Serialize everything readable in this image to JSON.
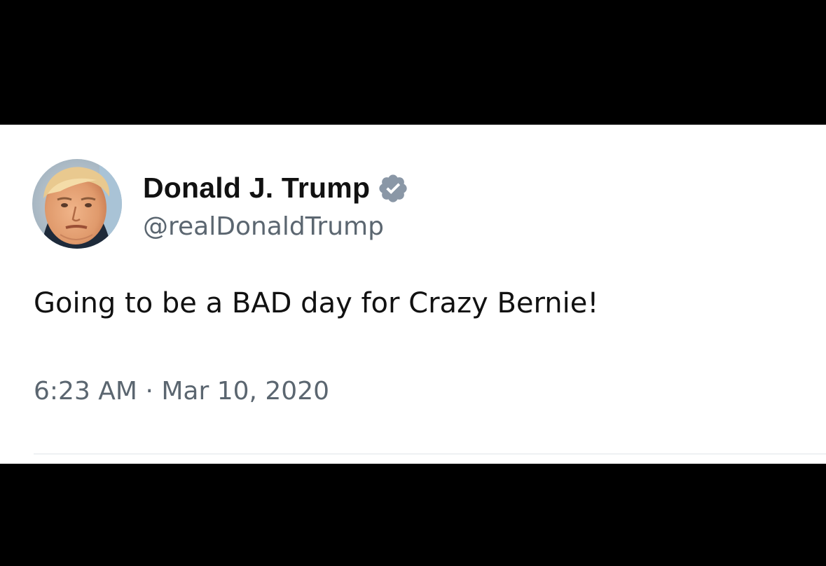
{
  "tweet": {
    "display_name": "Donald J. Trump",
    "handle": "@realDonaldTrump",
    "verified": true,
    "text": "Going to be a BAD day for Crazy Bernie!",
    "time": "6:23 AM",
    "separator": "·",
    "date": "Mar 10, 2020"
  },
  "icons": {
    "avatar": "avatar-photo",
    "badge": "verified-badge-icon"
  },
  "colors": {
    "background": "#000000",
    "card": "#ffffff",
    "primary_text": "#111111",
    "secondary_text": "#5b6670",
    "badge": "#8a97a6"
  }
}
